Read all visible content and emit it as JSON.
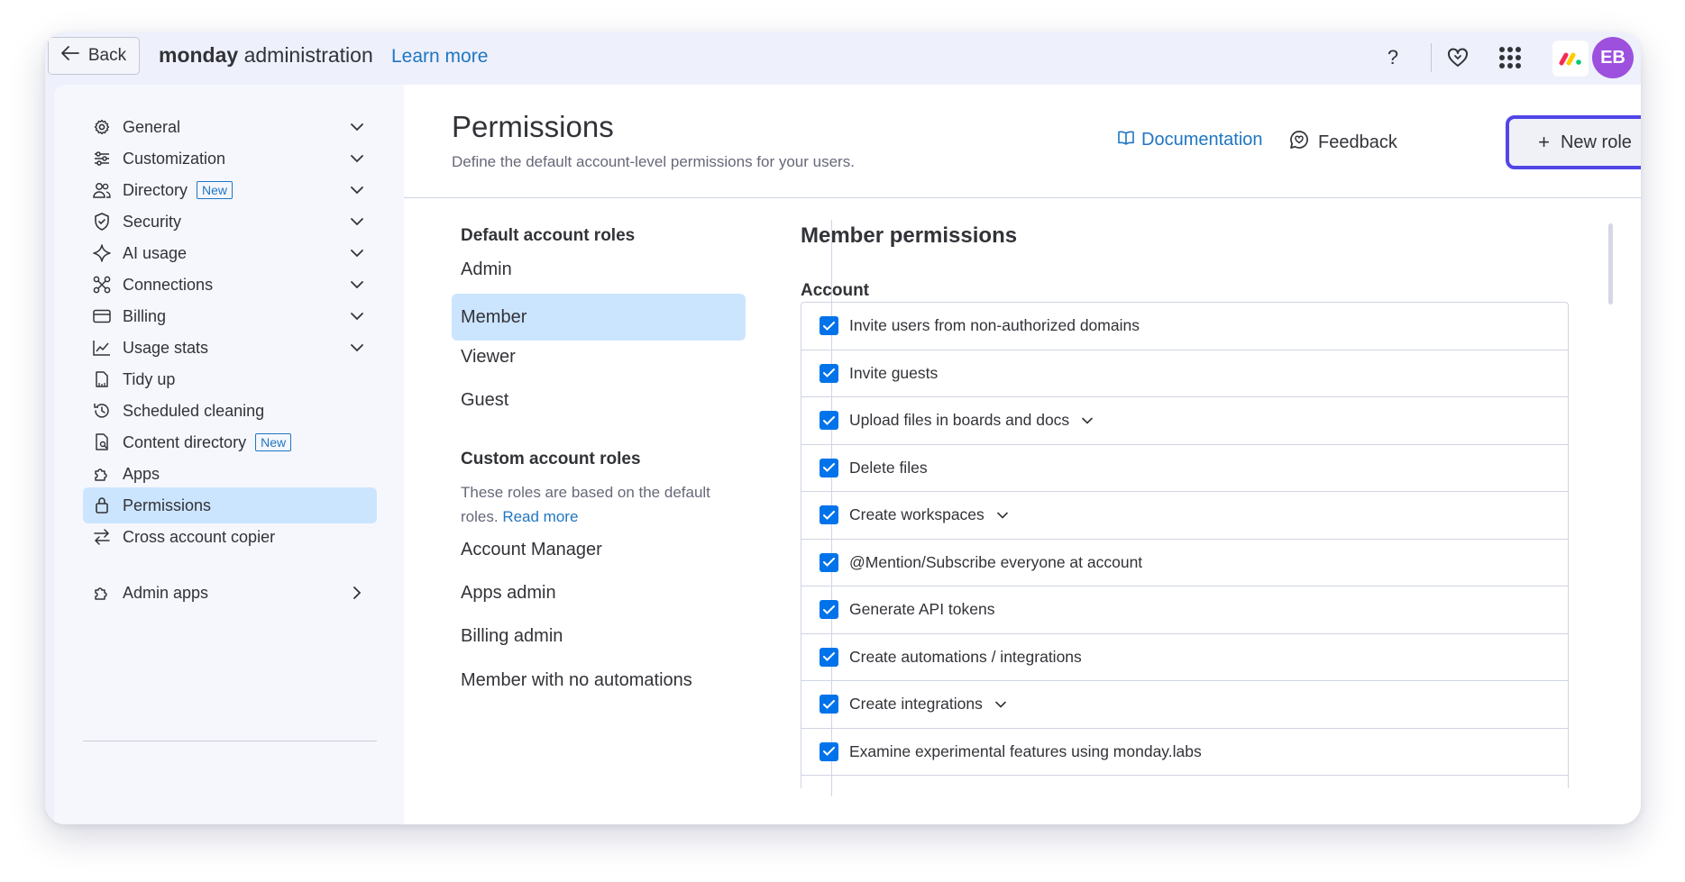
{
  "topbar": {
    "back_label": "Back",
    "title_bold": "monday",
    "title_rest": " administration",
    "learn_more": "Learn more",
    "help_glyph": "?",
    "avatar_initials": "EB",
    "icons": [
      "help-icon",
      "heart-icon",
      "apps-grid-icon",
      "monday-logo-icon"
    ]
  },
  "sidebar": {
    "items": [
      {
        "label": "General",
        "icon": "gear-icon",
        "chevron": "down"
      },
      {
        "label": "Customization",
        "icon": "sliders-icon",
        "chevron": "down"
      },
      {
        "label": "Directory",
        "icon": "users-icon",
        "chevron": "down",
        "badge": "New"
      },
      {
        "label": "Security",
        "icon": "shield-icon",
        "chevron": "down"
      },
      {
        "label": "AI usage",
        "icon": "sparkle-icon",
        "chevron": "down"
      },
      {
        "label": "Connections",
        "icon": "connections-icon",
        "chevron": "down"
      },
      {
        "label": "Billing",
        "icon": "card-icon",
        "chevron": "down"
      },
      {
        "label": "Usage stats",
        "icon": "chart-icon",
        "chevron": "down"
      },
      {
        "label": "Tidy up",
        "icon": "broom-icon"
      },
      {
        "label": "Scheduled cleaning",
        "icon": "clock-refresh-icon"
      },
      {
        "label": "Content directory",
        "icon": "content-icon",
        "badge": "New"
      },
      {
        "label": "Apps",
        "icon": "puzzle-icon"
      },
      {
        "label": "Permissions",
        "icon": "lock-icon",
        "active": true
      },
      {
        "label": "Cross account copier",
        "icon": "swap-icon"
      }
    ],
    "admin_apps": {
      "label": "Admin apps",
      "icon": "puzzle-icon",
      "chevron": "right"
    }
  },
  "header": {
    "title": "Permissions",
    "subtitle": "Define the default account-level permissions for your users.",
    "documentation": "Documentation",
    "feedback": "Feedback",
    "new_role_plus": "+",
    "new_role": "New role"
  },
  "roles": {
    "default_title": "Default account roles",
    "default": [
      "Admin",
      "Member",
      "Viewer",
      "Guest"
    ],
    "active_role": "Member",
    "custom_title": "Custom account roles",
    "custom_desc": "These roles are based on the default roles.",
    "read_more": "Read more",
    "custom": [
      "Account Manager",
      "Apps admin",
      "Billing admin",
      "Member with no automations"
    ]
  },
  "permissions": {
    "title": "Member permissions",
    "section": "Account",
    "items": [
      {
        "label": "Invite users from non-authorized domains",
        "checked": true,
        "expandable": false
      },
      {
        "label": "Invite guests",
        "checked": true,
        "expandable": false
      },
      {
        "label": "Upload files in boards and docs",
        "checked": true,
        "expandable": true
      },
      {
        "label": "Delete files",
        "checked": true,
        "expandable": false
      },
      {
        "label": "Create workspaces",
        "checked": true,
        "expandable": true
      },
      {
        "label": "@Mention/Subscribe everyone at account",
        "checked": true,
        "expandable": false
      },
      {
        "label": "Generate API tokens",
        "checked": true,
        "expandable": false
      },
      {
        "label": "Create automations / integrations",
        "checked": true,
        "expandable": false
      },
      {
        "label": "Create integrations",
        "checked": true,
        "expandable": true
      },
      {
        "label": "Examine experimental features using monday.labs",
        "checked": true,
        "expandable": false
      }
    ]
  },
  "colors": {
    "accent": "#0073ea",
    "link": "#1f76c2",
    "active_bg": "#cce5ff",
    "new_role_border": "#5145e8",
    "avatar": "#9d50dd"
  }
}
